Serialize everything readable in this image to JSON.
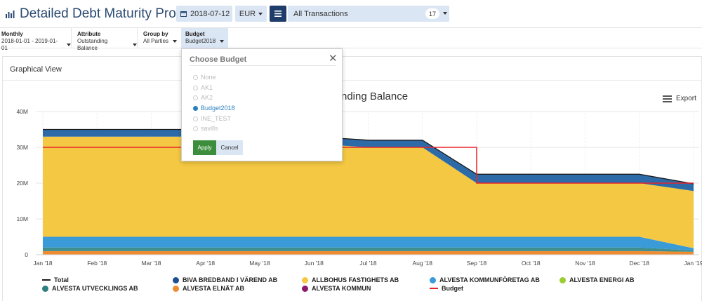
{
  "header": {
    "title": "Detailed Debt Maturity Profile",
    "date": "2018-07-12",
    "currency": "EUR",
    "transactions_label": "All Transactions",
    "transactions_count": "17"
  },
  "filters": {
    "monthly": {
      "label": "Monthly",
      "value": "2018-01-01 - 2019-01-01"
    },
    "attribute": {
      "label": "Attribute",
      "value": "Outstanding Balance"
    },
    "group_by": {
      "label": "Group by",
      "value": "All Parties"
    },
    "budget": {
      "label": "Budget",
      "value": "Budget2018"
    }
  },
  "panel": {
    "title": "Graphical View",
    "export_label": "Export"
  },
  "modal": {
    "title": "Choose Budget",
    "close_glyph": "✕",
    "options": [
      "None",
      "AK1",
      "AK2",
      "Budget2018",
      "INE_TEST",
      "savills"
    ],
    "selected": "Budget2018",
    "apply_label": "Apply",
    "cancel_label": "Cancel"
  },
  "chart_data": {
    "type": "area",
    "title_visible_fragment": "nding Balance",
    "categories": [
      "Jan '18",
      "Feb '18",
      "Mar '18",
      "Apr '18",
      "May '18",
      "Jun '18",
      "Jul '18",
      "Aug '18",
      "Sep '18",
      "Oct '18",
      "Nov '18",
      "Dec '18",
      "Jan '19"
    ],
    "y_ticks": [
      "0",
      "10M",
      "20M",
      "30M",
      "40M"
    ],
    "ylim": [
      0,
      40
    ],
    "y_unit": "M",
    "stack_order_bottom_to_top": [
      "ALVESTA ELNÄT AB",
      "ALVESTA UTVECKLINGS AB",
      "ALVESTA KOMMUNFÖRETAG AB",
      "ALLBOHUS FASTIGHETS AB",
      "BIVA BREDBAND I VÄREND AB"
    ],
    "series": [
      {
        "name": "ALVESTA ELNÄT AB",
        "color": "#f08c30",
        "values": [
          1,
          1,
          1,
          1,
          1,
          1,
          1,
          1,
          1,
          1,
          1,
          1,
          0.8
        ]
      },
      {
        "name": "ALVESTA UTVECKLINGS AB",
        "color": "#3f8f8f",
        "values": [
          1,
          1,
          1,
          1,
          1,
          1,
          1,
          1,
          1,
          1,
          1,
          1,
          0.4
        ]
      },
      {
        "name": "ALVESTA KOMMUNFÖRETAG AB",
        "color": "#3a9bd8",
        "values": [
          3,
          3,
          3,
          3,
          3,
          3,
          3,
          3,
          3,
          3,
          3,
          3,
          0.6
        ]
      },
      {
        "name": "ALLBOHUS FASTIGHETS AB",
        "color": "#f4c842",
        "values": [
          28,
          28,
          28,
          28,
          28,
          26,
          25,
          25,
          15,
          15,
          15,
          15,
          16
        ]
      },
      {
        "name": "BIVA BREDBAND I VÄREND AB",
        "color": "#2d6aa8",
        "values": [
          2,
          2,
          2,
          2,
          2,
          2,
          2,
          2,
          2.5,
          2.5,
          2.5,
          2.5,
          2
        ]
      }
    ],
    "total": {
      "name": "Total",
      "color": "#1a1a1a",
      "values": [
        35,
        35,
        35,
        35,
        35,
        33,
        32,
        32,
        22.5,
        22.5,
        22.5,
        22.5,
        19.8
      ]
    },
    "budget": {
      "name": "Budget",
      "color": "#e8242a",
      "step": true,
      "values": [
        30,
        30,
        30,
        30,
        30,
        30,
        30,
        30,
        20,
        20,
        20,
        20,
        20
      ]
    },
    "legend": [
      {
        "name": "Total",
        "marker": "line",
        "color": "#1a1a1a"
      },
      {
        "name": "BIVA BREDBAND I VÄREND AB",
        "marker": "dot",
        "color": "#1f4f8f"
      },
      {
        "name": "ALLBOHUS FASTIGHETS AB",
        "marker": "dot",
        "color": "#f4c842"
      },
      {
        "name": "ALVESTA KOMMUNFÖRETAG AB",
        "marker": "dot",
        "color": "#3a9bd8"
      },
      {
        "name": "ALVESTA ENERGI AB",
        "marker": "dot",
        "color": "#9acd32"
      },
      {
        "name": "ALVESTA UTVECKLINGS AB",
        "marker": "dot",
        "color": "#2f7f7f"
      },
      {
        "name": "ALVESTA ELNÄT AB",
        "marker": "dot",
        "color": "#f08c30"
      },
      {
        "name": "ALVESTA KOMMUN",
        "marker": "dot",
        "color": "#8b1a6b"
      },
      {
        "name": "Budget",
        "marker": "line",
        "color": "#e8242a"
      }
    ],
    "legend_placement": "bottom",
    "grid": true
  }
}
